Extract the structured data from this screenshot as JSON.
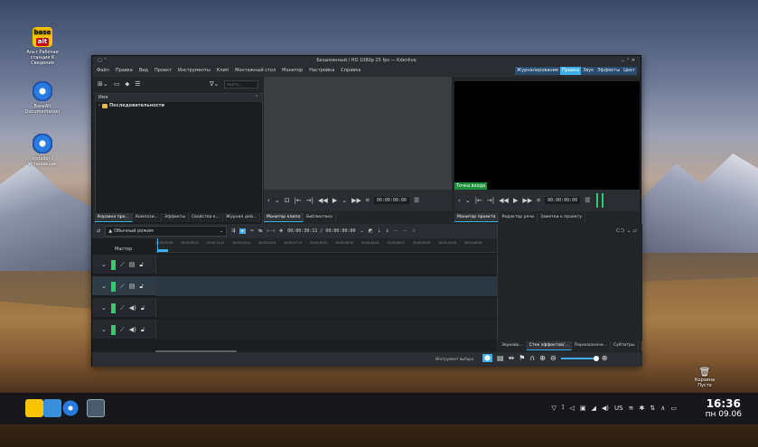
{
  "desktop": {
    "icons": [
      {
        "label": "Альт Рабочая станция К Сведения",
        "kind": "logo"
      },
      {
        "label": "BaseAlt Documentation",
        "kind": "disc"
      },
      {
        "label": "Installer / Установщик",
        "kind": "disc"
      }
    ],
    "logo_text_top": "base",
    "logo_text_bottom": "alt",
    "trash_label": "Корзина",
    "trash_sub": "Пусто"
  },
  "window": {
    "title": "Безымянный / HD 1080p 25 fps — Kdenlive",
    "menu": [
      "Файл",
      "Правка",
      "Вид",
      "Проект",
      "Инструменты",
      "Клип",
      "Монтажный стол",
      "Монитор",
      "Настройка",
      "Справка"
    ],
    "workspaces": [
      {
        "label": "Журналирование",
        "active": false
      },
      {
        "label": "Правка",
        "active": true
      },
      {
        "label": "Звук",
        "active": false
      },
      {
        "label": "Эффекты",
        "active": false
      },
      {
        "label": "Цвет",
        "active": false
      }
    ]
  },
  "bin": {
    "search_placeholder": "Найти...",
    "header_name": "Имя",
    "folder": "Последовательности"
  },
  "clip_monitor": {
    "timecode": "00:00:00:00"
  },
  "project_monitor": {
    "in_point": "Точка входа",
    "timecode": "00:00:00:00"
  },
  "left_tabs": [
    {
      "label": "Корзина про...",
      "active": true
    },
    {
      "label": "Компози...",
      "active": false
    },
    {
      "label": "Эффекты",
      "active": false
    },
    {
      "label": "Свойства к...",
      "active": false
    },
    {
      "label": "Журнал дей...",
      "active": false
    }
  ],
  "center_tabs": [
    {
      "label": "Монитор клипа",
      "active": true
    },
    {
      "label": "Библиотека",
      "active": false
    }
  ],
  "right_tabs": [
    {
      "label": "Монитор проекта",
      "active": true
    },
    {
      "label": "Редактор речи",
      "active": false
    },
    {
      "label": "Заметки к проекту",
      "active": false
    }
  ],
  "timeline": {
    "mode": "Обычный режим",
    "timecode": "00:00:30:11 / 00:00:00:00",
    "master_label": "Мастер",
    "ruler_ticks": [
      "00:00:00:00",
      "00:00:05:13",
      "00:00:11:01",
      "00:00:16:14",
      "00:00:22:02",
      "00:00:27:15",
      "00:00:33:03",
      "00:00:38:16",
      "00:00:44:04",
      "00:00:49:17",
      "00:00:55:05",
      "00:01:00:18",
      "00:01:06:06"
    ],
    "tracks": [
      {
        "type": "video",
        "selected": false
      },
      {
        "type": "video",
        "selected": true
      },
      {
        "type": "audio",
        "selected": false
      },
      {
        "type": "audio",
        "selected": false
      }
    ]
  },
  "bottom_right_tabs": [
    {
      "label": "Звуково...",
      "active": false
    },
    {
      "label": "Стек эффектов/...",
      "active": true
    },
    {
      "label": "Переназначе...",
      "active": false
    },
    {
      "label": "Субтитры",
      "active": false
    }
  ],
  "statusbar": {
    "tool_label": "Инструмент выбора"
  },
  "taskbar": {
    "tray_lang": "US",
    "time": "16:36",
    "date": "пн 09.06"
  }
}
